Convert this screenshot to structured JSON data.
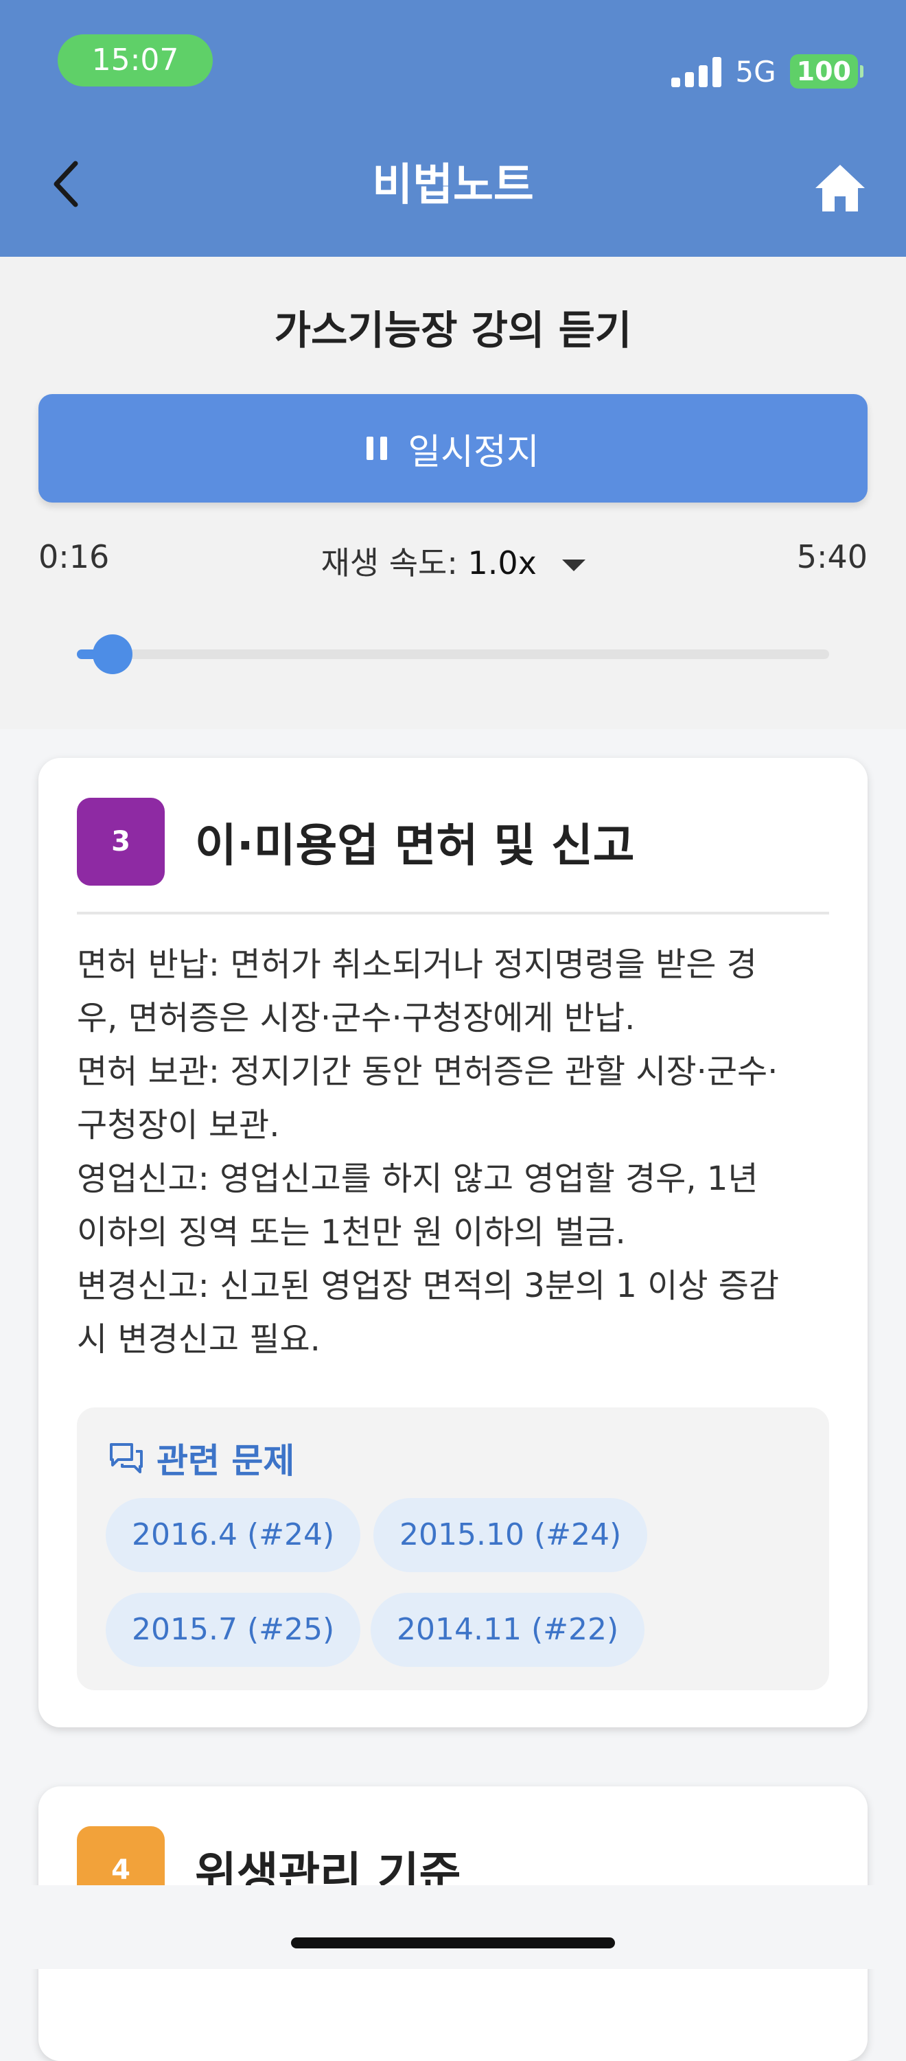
{
  "status_bar": {
    "time": "15:07",
    "network": "5G",
    "battery": "100"
  },
  "nav": {
    "title": "비법노트",
    "back_icon": "chevron-left-icon",
    "home_icon": "home-icon"
  },
  "player": {
    "title": "가스기능장 강의 듣기",
    "pause_label": "일시정지",
    "current_time": "0:16",
    "total_time": "5:40",
    "speed_label": "재생 속도:",
    "speed_value": "1.0x",
    "progress_fraction": 0.047
  },
  "cards": [
    {
      "number": "3",
      "title": "이·미용업 면허 및 신고",
      "badge_color": "#8e2aa3",
      "lines": [
        "면허 반납: 면허가 취소되거나 정지명령을 받은 경",
        "우, 면허증은 시장·군수·구청장에게 반납.",
        "면허 보관: 정지기간 동안 면허증은 관할 시장·군수·",
        "구청장이 보관.",
        "영업신고: 영업신고를 하지 않고 영업할 경우, 1년",
        "이하의 징역 또는 1천만 원 이하의 벌금.",
        "변경신고: 신고된 영업장 면적의 3분의 1 이상 증감",
        "시 변경신고 필요."
      ],
      "related_title": "관련 문제",
      "related_chips": [
        "2016.4 (#24)",
        "2015.10 (#24)",
        "2015.7 (#25)",
        "2014.11 (#22)"
      ]
    },
    {
      "number": "4",
      "title": "위생관리 기준",
      "badge_color": "#f2a23a"
    }
  ],
  "colors": {
    "header": "#5b8acf",
    "accent": "#4d8de6",
    "link": "#3d74c8"
  }
}
